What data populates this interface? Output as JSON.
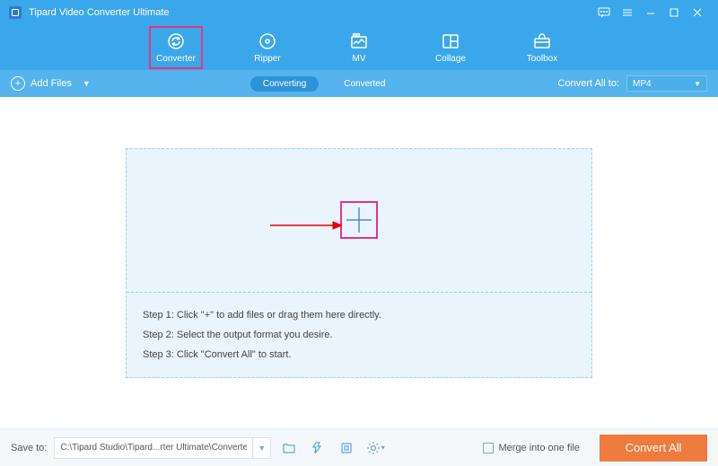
{
  "titlebar": {
    "title": "Tipard Video Converter Ultimate"
  },
  "nav": {
    "items": [
      {
        "label": "Converter",
        "icon": "converter"
      },
      {
        "label": "Ripper",
        "icon": "ripper"
      },
      {
        "label": "MV",
        "icon": "mv"
      },
      {
        "label": "Collage",
        "icon": "collage"
      },
      {
        "label": "Toolbox",
        "icon": "toolbox"
      }
    ]
  },
  "toolbar": {
    "add_files": "Add Files",
    "converting": "Converting",
    "converted": "Converted",
    "convert_all_to": "Convert All to:",
    "output_format": "MP4"
  },
  "drop": {
    "step1": "Step 1: Click \"+\" to add files or drag them here directly.",
    "step2": "Step 2: Select the output format you desire.",
    "step3": "Step 3: Click \"Convert All\" to start."
  },
  "footer": {
    "save_to_label": "Save to:",
    "save_path": "C:\\Tipard Studio\\Tipard...rter Ultimate\\Converted",
    "merge_label": "Merge into one file",
    "convert_all": "Convert All"
  }
}
